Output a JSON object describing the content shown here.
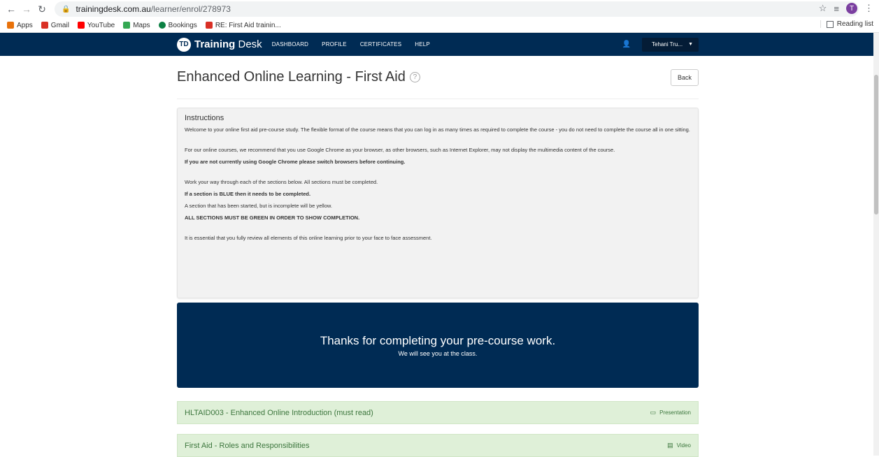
{
  "browser": {
    "url_host": "trainingdesk.com.au",
    "url_path": "/learner/enrol/278973",
    "profile_initial": "T",
    "bookmarks": [
      {
        "label": "Apps",
        "color": "#e8710a"
      },
      {
        "label": "Gmail",
        "color": "#d93025"
      },
      {
        "label": "YouTube",
        "color": "#ff0000"
      },
      {
        "label": "Maps",
        "color": "#34a853"
      },
      {
        "label": "Bookings",
        "color": "#0b8043"
      },
      {
        "label": "RE: First Aid trainin...",
        "color": "#d93025"
      }
    ],
    "reading_list": "Reading list"
  },
  "nav": {
    "logo_badge": "TD",
    "logo_bold": "Training",
    "logo_rest": " Desk",
    "links": [
      "DASHBOARD",
      "PROFILE",
      "CERTIFICATES",
      "HELP"
    ],
    "user_name": "Tehani Tru..."
  },
  "page": {
    "title": "Enhanced Online Learning - First Aid",
    "back_label": "Back"
  },
  "instructions": {
    "title": "Instructions",
    "p1": "Welcome to your online first aid pre-course study. The flexible  format of the course means that you can log in as many times as required  to complete the course - you do not need to complete the course all in  one sitting.",
    "p2": "For our online courses, we recommend that  you use Google Chrome as your browser, as other browsers, such as  Internet Explorer, may not display the multimedia content of the  course.",
    "p3": "If you are not currently using Google Chrome please switch browsers before continuing.",
    "p4": "Work your way through each of the sections below. All sections must be completed.",
    "p5": "If a section is BLUE then it needs to be completed.",
    "p6": "A section that has been started, but is incomplete will be yellow.",
    "p7": "ALL SECTIONS MUST BE GREEN IN ORDER TO SHOW COMPLETION.",
    "p8": "It is essential that you fully review all elements of this online learning prior to your face to face assessment."
  },
  "completion": {
    "title": "Thanks for completing your pre-course work.",
    "subtitle": "We will see you at the class."
  },
  "sections": [
    {
      "title": "HLTAID003 - Enhanced Online Introduction (must read)",
      "type": "Presentation",
      "icon": "presentation-icon",
      "status_color": "#dff0d8"
    },
    {
      "title": "First Aid - Roles and Responsibilities",
      "type": "Video",
      "icon": "video-icon",
      "status_color": "#dff0d8"
    }
  ]
}
